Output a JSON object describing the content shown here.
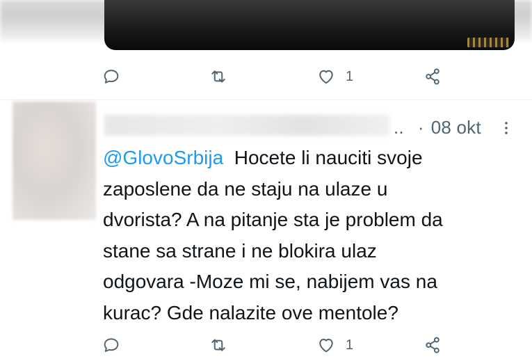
{
  "top_tweet": {
    "actions": {
      "reply_icon": "reply-icon",
      "retweet_icon": "retweet-icon",
      "like_icon": "heart-icon",
      "like_count": "1",
      "share_icon": "share-icon"
    }
  },
  "tweet": {
    "meta": {
      "truncation": "..",
      "separator": "·",
      "date": "08 okt"
    },
    "more_icon": "more-vertical-icon",
    "mention": "@GlovoSrbija",
    "lines": [
      "Hocete li nauciti svoje",
      "zaposlene da ne staju na ulaze u",
      "dvorista? A na pitanje sta je problem da",
      "stane sa strane i ne blokira ulaz",
      "odgovara -Moze mi se, nabijem vas na",
      "kurac? Gde nalazite ove mentole?"
    ],
    "actions": {
      "reply_icon": "reply-icon",
      "retweet_icon": "retweet-icon",
      "like_icon": "heart-icon",
      "like_count": "1",
      "share_icon": "share-icon"
    }
  },
  "colors": {
    "text": "#0f1419",
    "secondary": "#536471",
    "link": "#1d9bf0",
    "divider": "#eff3f4"
  }
}
